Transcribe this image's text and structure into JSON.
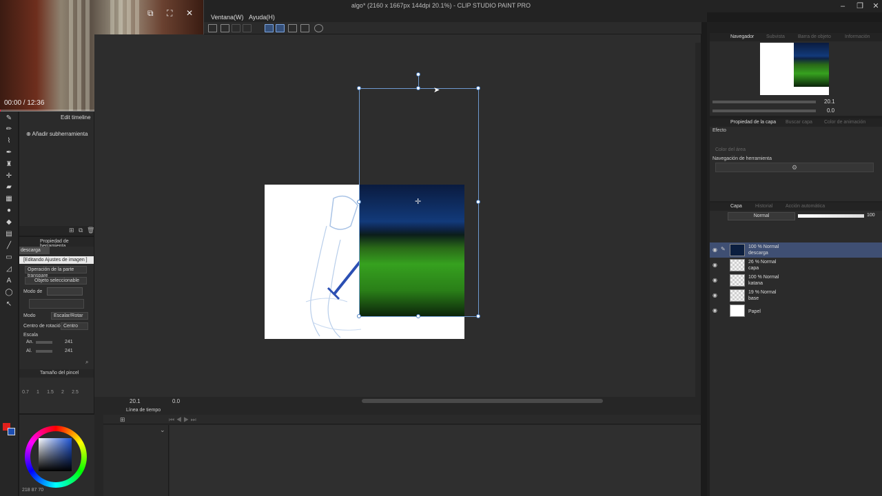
{
  "window": {
    "title": "algo* (2160 x 1667px 144dpi 20.1%)  - CLIP STUDIO PAINT PRO"
  },
  "menu": [
    {
      "label": "Ventana(W)"
    },
    {
      "label": "Ayuda(H)"
    }
  ],
  "video": {
    "timecode": "00:00 / 12:36",
    "progress": 0.0
  },
  "sub_tool": {
    "edit_timeline": "Edit timeline",
    "add_subtool": "Añadir subherramienta"
  },
  "tool_property": {
    "header": "Propiedad de herramienta",
    "tag": "descarga",
    "editing_banner": "[Editando Ajustes de imagen ]",
    "transparent_op": "Operación de la parte transpare",
    "selectable": "Objeto seleccionable",
    "mode_label": "Modo de",
    "mode": "Modo",
    "mode_value": "Escalar/Rotar",
    "rotation_center_label": "Centro de rotación",
    "rotation_center_value": "Centro",
    "scale": "Escala",
    "width_label": "An.",
    "width_value": "241",
    "height_label": "Al.",
    "height_value": "241"
  },
  "brush_size": {
    "header": "Tamaño del pincel",
    "values": [
      "0.7",
      "1",
      "1.5",
      "2",
      "2.5"
    ]
  },
  "color_readout": {
    "h": "218",
    "s": "87",
    "v": "70"
  },
  "canvas_bar": {
    "zoom": "20.1",
    "rotation": "0.0"
  },
  "timeline": {
    "header": "Línea de tiempo"
  },
  "navigator": {
    "tabs": [
      "Navegador",
      "Subvista",
      "Barra de objeto",
      "Información"
    ],
    "zoom": "20.1",
    "rotation": "0.0"
  },
  "layer_property": {
    "tabs": [
      "Propiedad de la capa",
      "Buscar capa",
      "Color de animación"
    ],
    "effect": "Efecto",
    "area_color": "Color del área",
    "tool_nav": "Navegación de herramienta"
  },
  "layers": {
    "tabs": [
      "Capa",
      "Historial",
      "Acción automática"
    ],
    "blend_mode": "Normal",
    "opacity": "100",
    "items": [
      {
        "opacity": "100 % Normal",
        "name": "descarga",
        "selected": true
      },
      {
        "opacity": "26 % Normal",
        "name": "capa",
        "selected": false
      },
      {
        "opacity": "100 % Normal",
        "name": "katana",
        "selected": false
      },
      {
        "opacity": "19 % Normal",
        "name": "base",
        "selected": false
      },
      {
        "opacity": "",
        "name": "Papel",
        "selected": false
      }
    ]
  },
  "colors": {
    "main": "#e0201c",
    "sub": "#1e4fb2",
    "selection": "#6f9bd2"
  }
}
